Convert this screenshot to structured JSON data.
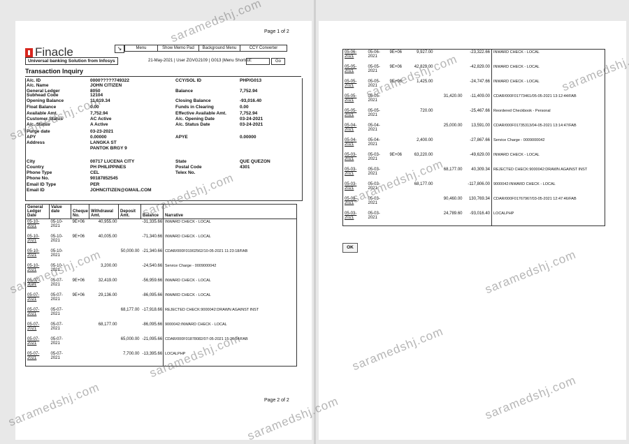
{
  "page1": {
    "page_label": "Page 1 of 2",
    "page_footer": "Page 2 of 2",
    "logo": "Finacle",
    "tagline": "Universal banking Solution from Infosys",
    "toolbar": {
      "icon": "pin-icon",
      "menu": "Menu",
      "show_memo": "Show Memo Pad",
      "background_menu": "Background Menu",
      "ccy_converter": "CCY Converter"
    },
    "userline": "21-May-2021 | User ZGVG2109 | G013 |Menu Shortcut:",
    "go": "Go",
    "title": "Transaction Inquiry",
    "fields": {
      "ac_id_label": "A/c. ID",
      "ac_id": "0000?????749322",
      "ac_name_label": "A/c. Name",
      "ac_name": "JOHN CITIZEN",
      "ccy_label": "CCY/SOL ID",
      "ccy": "PHP/G013",
      "gl_label": "General Ledger",
      "gl": "8050",
      "subhead_label": "Subhead Code",
      "subhead": "12104",
      "balance_label": "Balance",
      "balance": "7,752.94",
      "opening_balance_label": "Opening Balance",
      "opening_balance": "11,619.34",
      "closing_balance_label": "Closing Balance",
      "closing_balance": "-93,016.40",
      "float_label": "Float Balance",
      "float": "0.00",
      "funds_label": "Funds in Clearing",
      "funds": "0.00",
      "available_label": "Available Amt.",
      "available": "7,752.94",
      "effective_label": "Effective Available Amt.",
      "effective": "7,752.94",
      "cust_status_label": "Customer Status",
      "cust_status": "AC Active",
      "ac_open_label": "A/c. Opening Date",
      "ac_open": "03-24-2021",
      "ac_status_label": "A/c. Status",
      "ac_status": "A Active",
      "ac_status_date_label": "A/c. Status Date",
      "ac_status_date": "03-24-2021",
      "purge_label": "Purge date",
      "purge": "03-23-2021",
      "apy_label": "APY",
      "apy": "0.00000",
      "apye_label": "APYE",
      "apye": "0.00000",
      "address_label": "Address",
      "address1": "LANGKA ST",
      "address2": "PANTOK BRGY 9",
      "city_label": "City",
      "city": "00717 LUCENA CITY",
      "state_label": "State",
      "state": "QUE QUEZON",
      "country_label": "Country",
      "country": "PH PHILIPPINES",
      "postal_label": "Postal Code",
      "postal": "4301",
      "phone_type_label": "Phone Type",
      "phone_type": "CEL",
      "telex_label": "Telex No.",
      "telex": "",
      "phone_label": "Phone No.",
      "phone": "90187852545",
      "email_type_label": "Email ID Type",
      "email_type": "PER",
      "email_label": "Email ID",
      "email": "JOHNCITIZEN@GMAIL.COM"
    },
    "columns": [
      "General Ledger Date",
      "Value date",
      "Cheque No.",
      "Withdrawal Amt.",
      "Deposit Amt.",
      "Balance",
      "Narrative"
    ],
    "rows": [
      {
        "date": "05-10-2021",
        "value": "05-10-2021",
        "cheque": "9E+06",
        "wd": "40,955.00",
        "dep": "",
        "bal": "-31,335.66",
        "nar": "INWARD CHECK - LOCAL"
      },
      {
        "date": "05-10-2021",
        "value": "05-10-2021",
        "cheque": "9E+06",
        "wd": "40,005.00",
        "dep": "",
        "bal": "-71,340.66",
        "nar": "INWARD CHECK - LOCAL"
      },
      {
        "date": "05-10-2021",
        "value": "05-10-2021",
        "cheque": "",
        "wd": "",
        "dep": "50,000.00",
        "bal": "-21,340.66",
        "nar": "CDAR/000F01902562/10-05-2021 11:23:18/FAB"
      },
      {
        "date": "05-10-2021",
        "value": "05-10-2021",
        "cheque": "",
        "wd": "3,200.00",
        "dep": "",
        "bal": "-24,540.66",
        "nar": "Service Charge - 0009000042"
      },
      {
        "date": "05-07-2021",
        "value": "05-07-2021",
        "cheque": "9E+06",
        "wd": "32,419.00",
        "dep": "",
        "bal": "-56,959.66",
        "nar": "INWARD CHECK - LOCAL"
      },
      {
        "date": "05-07-2021",
        "value": "05-07-2021",
        "cheque": "9E+06",
        "wd": "29,136.00",
        "dep": "",
        "bal": "-86,095.66",
        "nar": "INWARD CHECK - LOCAL"
      },
      {
        "date": "05-07-2021",
        "value": "05-07-2021",
        "cheque": "",
        "wd": "",
        "dep": "68,177.00",
        "bal": "-17,918.66",
        "nar": "REJECTED CHECK:9000042:DRAWN AGAINST INST"
      },
      {
        "date": "05-07-2021",
        "value": "05-07-2021",
        "cheque": "",
        "wd": "68,177.00",
        "dep": "",
        "bal": "-86,095.66",
        "nar": "9000042:INWARD CHECK - LOCAL"
      },
      {
        "date": "05-07-2021",
        "value": "05-07-2021",
        "cheque": "",
        "wd": "",
        "dep": "65,000.00",
        "bal": "-21,095.66",
        "nar": "CDAR/000F01878082/07-05-2021 15:26:54/FAB"
      },
      {
        "date": "05-07-2021",
        "value": "05-07-2021",
        "cheque": "",
        "wd": "",
        "dep": "7,700.00",
        "bal": "-13,395.66",
        "nar": "LOCALPHP"
      }
    ]
  },
  "page2": {
    "rows": [
      {
        "date": "05-06-2021",
        "value": "05-06-2021",
        "cheque": "9E+06",
        "wd": "9,927.00",
        "dep": "",
        "bal": "-23,322.66",
        "nar": "INWARD CHECK - LOCAL"
      },
      {
        "date": "05-05-2021",
        "value": "05-05-2021",
        "cheque": "9E+06",
        "wd": "42,829.00",
        "dep": "",
        "bal": "-42,829.00",
        "nar": "INWARD CHECK - LOCAL"
      },
      {
        "date": "05-05-2021",
        "value": "05-05-2021",
        "cheque": "9E+06",
        "wd": "1,425.00",
        "dep": "",
        "bal": "-24,747.66",
        "nar": "INWARD CHECK - LOCAL"
      },
      {
        "date": "05-05-2021",
        "value": "05-05-2021",
        "cheque": "",
        "wd": "",
        "dep": "31,420.00",
        "bal": "-11,409.00",
        "nar": "CDAR/000F01773461/05-05-2021 13:12:44/FAB"
      },
      {
        "date": "05-05-2021",
        "value": "05-05-2021",
        "cheque": "",
        "wd": "720.00",
        "dep": "",
        "bal": "-25,467.66",
        "nar": "Reordered Checkbook - Personal"
      },
      {
        "date": "05-04-2021",
        "value": "05-04-2021",
        "cheque": "",
        "wd": "",
        "dep": "25,000.00",
        "bal": "13,591.00",
        "nar": "CDAR/000F01735313/04-05-2021 13:14:47/FAB"
      },
      {
        "date": "05-04-2021",
        "value": "05-04-2021",
        "cheque": "",
        "wd": "2,400.00",
        "dep": "",
        "bal": "-27,867.66",
        "nar": "Service Charge - 0009000042"
      },
      {
        "date": "05-03-2021",
        "value": "05-03-2021",
        "cheque": "9E+06",
        "wd": "63,220.00",
        "dep": "",
        "bal": "-49,629.00",
        "nar": "INWARD CHECK - LOCAL"
      },
      {
        "date": "05-03-2021",
        "value": "05-03-2021",
        "cheque": "",
        "wd": "",
        "dep": "68,177.00",
        "bal": "40,309.34",
        "nar": "REJECTED CHECK:9000042:DRAWN AGAINST INST"
      },
      {
        "date": "05-03-2021",
        "value": "05-03-2021",
        "cheque": "",
        "wd": "68,177.00",
        "dep": "",
        "bal": "-117,806.00",
        "nar": "9000042:INWARD CHECK - LOCAL"
      },
      {
        "date": "05-03-2021",
        "value": "05-03-2021",
        "cheque": "",
        "wd": "",
        "dep": "90,460.00",
        "bal": "130,769.34",
        "nar": "CDAR/000F01767967/03-05-2021 12:47:46/FAB"
      },
      {
        "date": "05-03-2021",
        "value": "05-03-2021",
        "cheque": "",
        "wd": "",
        "dep": "24,789.60",
        "bal": "-93,016.40",
        "nar": "LOCALPHP"
      }
    ],
    "ok": "OK"
  },
  "watermark": "saramedshj.com"
}
